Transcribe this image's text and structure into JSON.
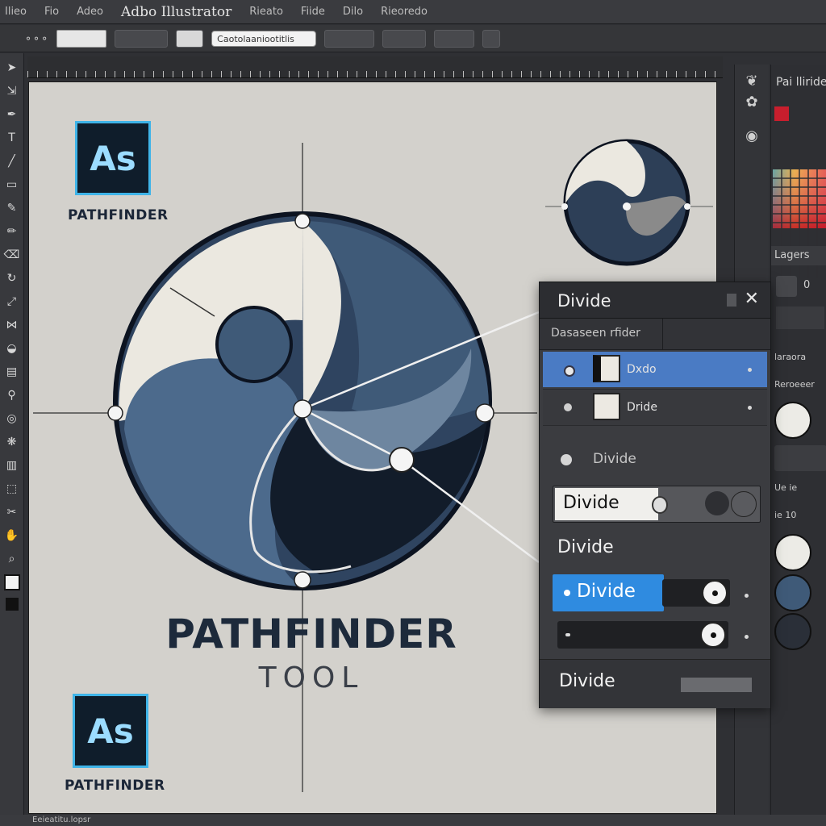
{
  "menubar": {
    "brand": "Adbo Illustrator",
    "items": [
      "Ilieo",
      "Fio",
      "Adeo",
      "Rieato",
      "Fiide",
      "Dilo",
      "Rieoredo"
    ]
  },
  "controlbar": {
    "input_value": "Caotolaaniootitlis"
  },
  "toolbar": {
    "icons": [
      "selection-tool-icon",
      "direct-select-icon",
      "pen-tool-icon",
      "type-tool-icon",
      "line-tool-icon",
      "rectangle-tool-icon",
      "brush-tool-icon",
      "pencil-tool-icon",
      "eraser-tool-icon",
      "rotate-tool-icon",
      "scale-tool-icon",
      "width-tool-icon",
      "shape-builder-icon",
      "gradient-tool-icon",
      "eyedropper-tool-icon",
      "blend-tool-icon",
      "symbol-tool-icon",
      "graph-tool-icon",
      "artboard-tool-icon",
      "slice-tool-icon",
      "hand-tool-icon",
      "zoom-tool-icon"
    ]
  },
  "artboard": {
    "logo_top": {
      "text": "As",
      "caption": "PATHFINDER"
    },
    "logo_bottom": {
      "text": "As",
      "caption": "PATHFINDER"
    },
    "title": "PATHFINDER",
    "subtitle": "TOOL",
    "colors": {
      "dark": "#111c2b",
      "mid": "#3f5a78",
      "light": "#ebe8e0",
      "accent_logo": "#3fb4e8"
    }
  },
  "pathfinder_panel": {
    "title": "Divide",
    "close": "✕",
    "tab_label": "Dasaseen rfider",
    "rows": [
      {
        "label": "Dxdo",
        "selected": true
      },
      {
        "label": "Dride",
        "selected": false
      }
    ],
    "option_label": "Divide",
    "field_value": "Divide",
    "section_label": "Divide",
    "button_label": "Divide",
    "footer_label": "Divide"
  },
  "right_panel": {
    "title": "Pai lliride",
    "layers_label": "Lagers",
    "number": "0",
    "label_a": "laraora",
    "label_b": "Reroeeer",
    "label_c": "Ue ie",
    "label_d": "ie 10",
    "accent": "#c81e2d"
  },
  "statusbar": {
    "text": "Eeieatitu.lopsr"
  }
}
